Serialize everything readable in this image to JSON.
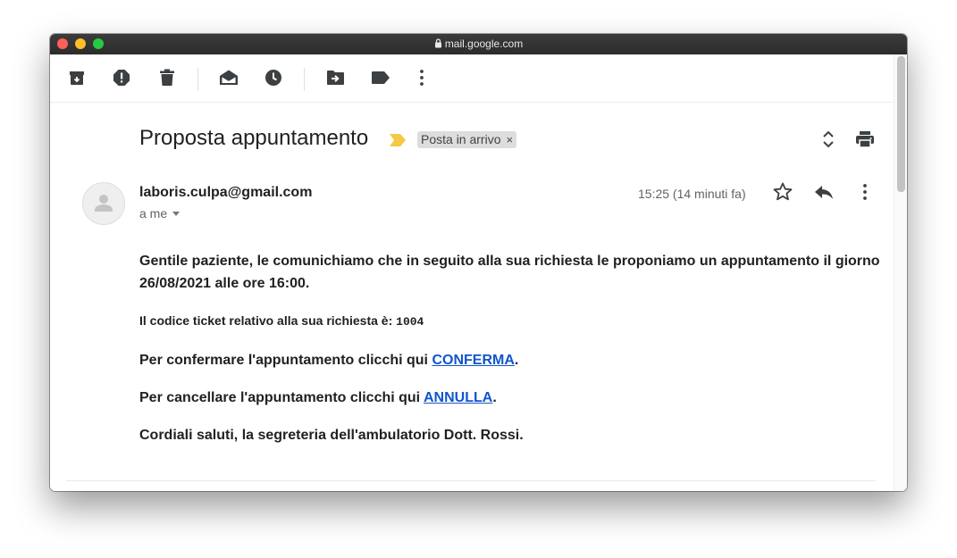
{
  "browser": {
    "url": "mail.google.com"
  },
  "toolbar": {
    "items": [
      {
        "name": "archive-icon"
      },
      {
        "name": "report-spam-icon"
      },
      {
        "name": "delete-icon"
      },
      {
        "name": "mark-unread-icon"
      },
      {
        "name": "snooze-icon"
      },
      {
        "name": "move-to-icon"
      },
      {
        "name": "label-icon"
      },
      {
        "name": "more-vert-icon"
      }
    ]
  },
  "email": {
    "subject": "Proposta appuntamento",
    "label_chip": "Posta in arrivo",
    "label_chip_close": "×",
    "sender": "laboris.culpa@gmail.com",
    "recipient": "a me",
    "timestamp": "15:25 (14 minuti fa)",
    "body": {
      "p1": "Gentile paziente, le comunichiamo che in seguito alla sua richiesta le proponiamo un appuntamento il giorno 26/08/2021 alle ore 16:00.",
      "p2_text": "Il codice ticket relativo alla sua richiesta è: ",
      "p2_code": "1004",
      "p3_text": "Per confermare l'appuntamento clicchi qui ",
      "p3_link": "CONFERMA",
      "p3_end": ".",
      "p4_text": "Per cancellare l'appuntamento clicchi qui ",
      "p4_link": "ANNULLA",
      "p4_end": ".",
      "p5": "Cordiali saluti, la segreteria dell'ambulatorio Dott. Rossi."
    }
  },
  "colors": {
    "link": "#1155cc",
    "importance_marker": "#f7c843",
    "icon": "#3c4043"
  }
}
